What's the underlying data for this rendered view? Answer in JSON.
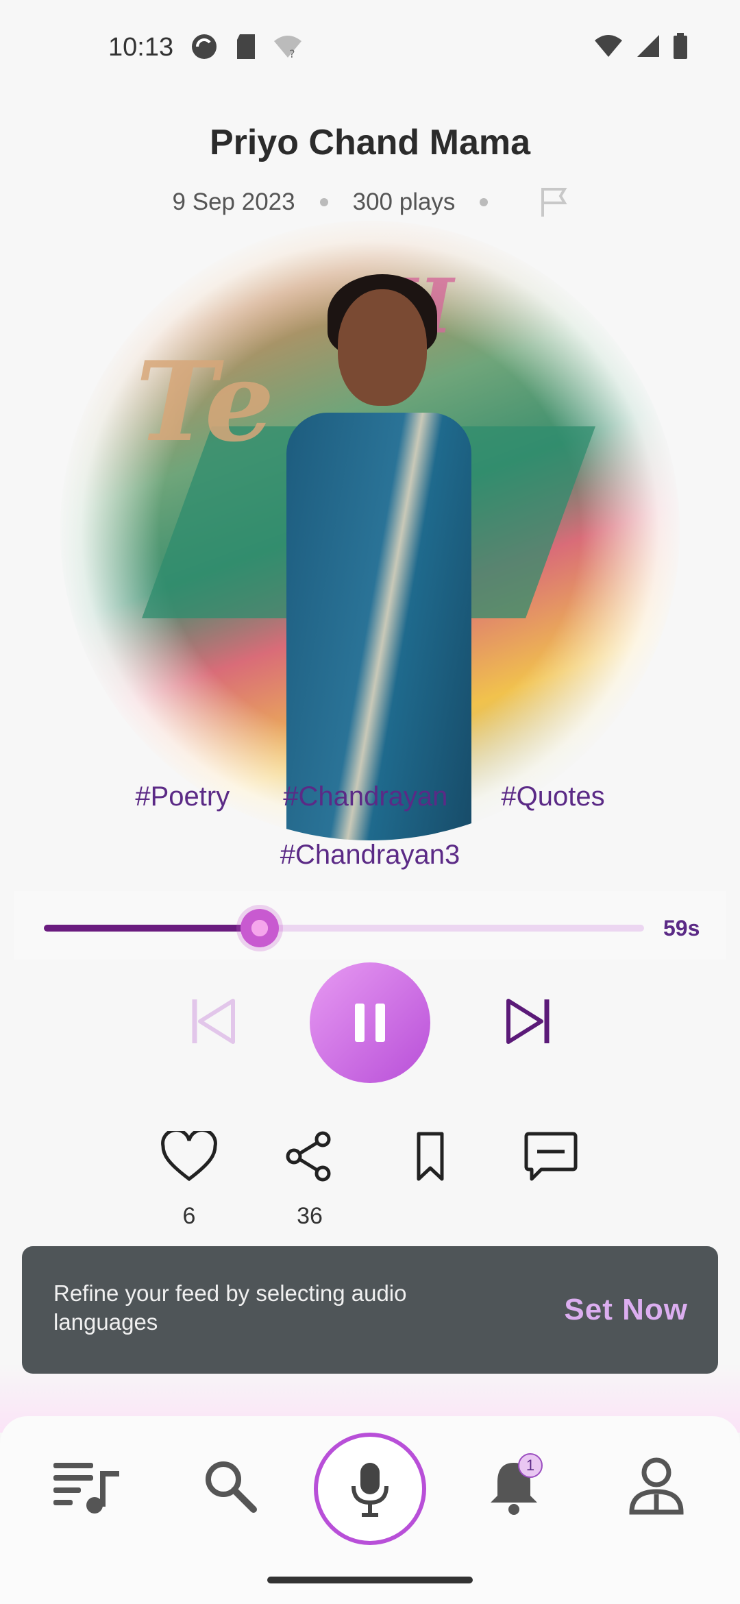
{
  "status_bar": {
    "time": "10:13"
  },
  "track": {
    "title": "Priyo Chand Mama",
    "date": "9 Sep 2023",
    "plays": "300 plays"
  },
  "tags": [
    "#Poetry",
    "#Chandrayan",
    "#Quotes",
    "#Chandrayan3"
  ],
  "player": {
    "progress": 0.36,
    "remaining": "59s",
    "state": "playing"
  },
  "actions": {
    "likes": "6",
    "shares": "36"
  },
  "snackbar": {
    "message": "Refine your feed by selecting audio languages",
    "action": "Set Now"
  },
  "bottom_nav": {
    "items": [
      "playlist-icon",
      "search-icon",
      "mic-icon",
      "bell-icon",
      "profile-icon"
    ],
    "notification_count": "1"
  },
  "colors": {
    "accent": "#b84fd8",
    "accent_dark": "#5b2a86",
    "snackbar_bg": "#4f5558"
  }
}
